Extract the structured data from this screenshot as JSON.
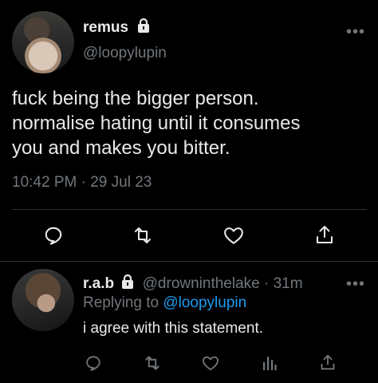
{
  "main_tweet": {
    "display_name": "remus",
    "handle": "@loopylupin",
    "text_lines": [
      "fuck being the bigger person.",
      "normalise hating until it consumes",
      "you and makes you bitter."
    ],
    "timestamp": "10:42 PM · 29 Jul 23",
    "icons": {
      "more": "more-icon",
      "reply": "reply-icon",
      "retweet": "retweet-icon",
      "like": "like-icon",
      "share": "share-icon",
      "lock": "lock-icon"
    }
  },
  "reply_tweet": {
    "display_name": "r.a.b",
    "handle_time": "@drowninthelake · 31m",
    "replying_prefix": "Replying to",
    "replying_handle": "@loopylupin",
    "text": "i agree with this statement.",
    "icons": {
      "more": "more-icon",
      "reply": "reply-icon",
      "retweet": "retweet-icon",
      "like": "like-icon",
      "analytics": "analytics-icon",
      "share": "share-icon",
      "lock": "lock-icon"
    }
  },
  "colors": {
    "background": "#000000",
    "text": "#e7e9ea",
    "muted": "#71767b",
    "link": "#1d9bf0",
    "divider": "#2f3336"
  }
}
